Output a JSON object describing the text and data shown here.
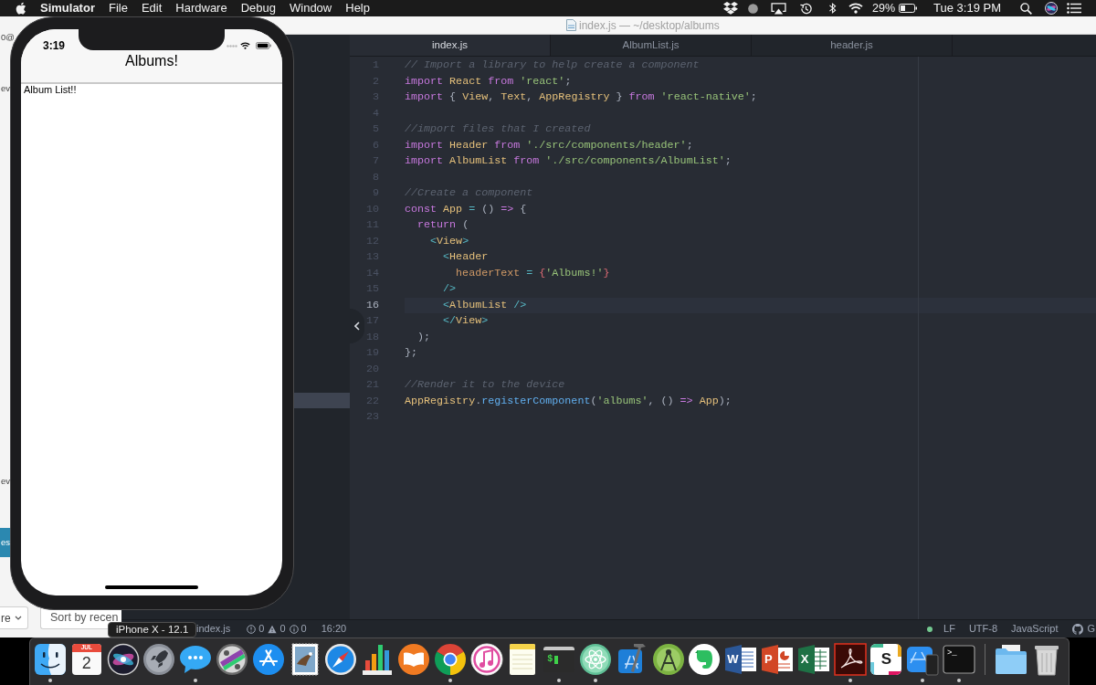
{
  "menu_bar": {
    "app_name": "Simulator",
    "menus": [
      "File",
      "Edit",
      "Hardware",
      "Debug",
      "Window",
      "Help"
    ],
    "battery": "29%",
    "clock": "Tue 3:19 PM"
  },
  "background_window": {
    "fragments": [
      "0@",
      "ev",
      "ev"
    ],
    "action_button": "es",
    "dropdown": "re",
    "sort_button": "Sort by recen"
  },
  "editor": {
    "title": "index.js — ~/desktop/albums",
    "tabs": [
      {
        "label": "index.js",
        "selected": true
      },
      {
        "label": "AlbumList.js",
        "selected": false
      },
      {
        "label": "header.js",
        "selected": false
      }
    ],
    "lines": [
      {
        "number": "1",
        "cursor": false,
        "tokens": [
          {
            "kind": "comment",
            "text": "// Import a library to help create a component"
          }
        ]
      },
      {
        "number": "2",
        "cursor": false,
        "tokens": [
          {
            "kind": "keyword",
            "text": "import "
          },
          {
            "kind": "name",
            "text": "React "
          },
          {
            "kind": "keyword",
            "text": "from "
          },
          {
            "kind": "string",
            "text": "'react'"
          },
          {
            "kind": "punct",
            "text": ";"
          }
        ]
      },
      {
        "number": "3",
        "cursor": false,
        "tokens": [
          {
            "kind": "keyword",
            "text": "import "
          },
          {
            "kind": "punct",
            "text": "{ "
          },
          {
            "kind": "name",
            "text": "View"
          },
          {
            "kind": "punct",
            "text": ", "
          },
          {
            "kind": "name",
            "text": "Text"
          },
          {
            "kind": "punct",
            "text": ", "
          },
          {
            "kind": "name",
            "text": "AppRegistry"
          },
          {
            "kind": "punct",
            "text": " } "
          },
          {
            "kind": "keyword",
            "text": "from "
          },
          {
            "kind": "string",
            "text": "'react-native'"
          },
          {
            "kind": "punct",
            "text": ";"
          }
        ]
      },
      {
        "number": "4",
        "cursor": false
      },
      {
        "number": "5",
        "cursor": false,
        "tokens": [
          {
            "kind": "comment",
            "text": "//import files that I created"
          }
        ]
      },
      {
        "number": "6",
        "cursor": false,
        "tokens": [
          {
            "kind": "keyword",
            "text": "import "
          },
          {
            "kind": "name",
            "text": "Header "
          },
          {
            "kind": "keyword",
            "text": "from "
          },
          {
            "kind": "string",
            "text": "'./src/components/header'"
          },
          {
            "kind": "punct",
            "text": ";"
          }
        ]
      },
      {
        "number": "7",
        "cursor": false,
        "tokens": [
          {
            "kind": "keyword",
            "text": "import "
          },
          {
            "kind": "name",
            "text": "AlbumList "
          },
          {
            "kind": "keyword",
            "text": "from "
          },
          {
            "kind": "string",
            "text": "'./src/components/AlbumList'"
          },
          {
            "kind": "punct",
            "text": ";"
          }
        ]
      },
      {
        "number": "8",
        "cursor": false
      },
      {
        "number": "9",
        "cursor": false,
        "tokens": [
          {
            "kind": "comment",
            "text": "//Create a component"
          }
        ]
      },
      {
        "number": "10",
        "cursor": false,
        "tokens": [
          {
            "kind": "keyword",
            "text": "const "
          },
          {
            "kind": "name",
            "text": "App "
          },
          {
            "kind": "operator",
            "text": "= "
          },
          {
            "kind": "punct",
            "text": "() "
          },
          {
            "kind": "keyword",
            "text": "=> "
          },
          {
            "kind": "punct",
            "text": "{"
          }
        ]
      },
      {
        "number": "11",
        "cursor": false,
        "tokens": [
          {
            "kind": "keyword",
            "text": "  return "
          },
          {
            "kind": "punct",
            "text": "("
          }
        ]
      },
      {
        "number": "12",
        "cursor": false,
        "tokens": [
          {
            "kind": "tag",
            "text": "    <"
          },
          {
            "kind": "name",
            "text": "View"
          },
          {
            "kind": "tag",
            "text": ">"
          }
        ]
      },
      {
        "number": "13",
        "cursor": false,
        "tokens": [
          {
            "kind": "tag",
            "text": "      <"
          },
          {
            "kind": "name",
            "text": "Header"
          }
        ]
      },
      {
        "number": "14",
        "cursor": false,
        "tokens": [
          {
            "kind": "attr",
            "text": "        headerText "
          },
          {
            "kind": "operator",
            "text": "= "
          },
          {
            "kind": "brace",
            "text": "{"
          },
          {
            "kind": "string",
            "text": "'Albums!'"
          },
          {
            "kind": "brace",
            "text": "}"
          }
        ]
      },
      {
        "number": "15",
        "cursor": false,
        "tokens": [
          {
            "kind": "tag",
            "text": "      />"
          }
        ]
      },
      {
        "number": "16",
        "cursor": true,
        "tokens": [
          {
            "kind": "tag",
            "text": "      <"
          },
          {
            "kind": "name",
            "text": "AlbumList "
          },
          {
            "kind": "tag",
            "text": "/>"
          }
        ]
      },
      {
        "number": "17",
        "cursor": false,
        "tokens": [
          {
            "kind": "tag",
            "text": "      </"
          },
          {
            "kind": "name",
            "text": "View"
          },
          {
            "kind": "tag",
            "text": ">"
          }
        ]
      },
      {
        "number": "18",
        "cursor": false,
        "tokens": [
          {
            "kind": "punct",
            "text": "  );"
          }
        ]
      },
      {
        "number": "19",
        "cursor": false,
        "tokens": [
          {
            "kind": "punct",
            "text": "};"
          }
        ]
      },
      {
        "number": "20",
        "cursor": false
      },
      {
        "number": "21",
        "cursor": false,
        "tokens": [
          {
            "kind": "comment",
            "text": "//Render it to the device"
          }
        ]
      },
      {
        "number": "22",
        "cursor": false,
        "tokens": [
          {
            "kind": "name",
            "text": "AppRegistry"
          },
          {
            "kind": "punct",
            "text": "."
          },
          {
            "kind": "func",
            "text": "registerComponent"
          },
          {
            "kind": "punct",
            "text": "("
          },
          {
            "kind": "string",
            "text": "'albums'"
          },
          {
            "kind": "punct",
            "text": ", () "
          },
          {
            "kind": "keyword",
            "text": "=> "
          },
          {
            "kind": "name",
            "text": "App"
          },
          {
            "kind": "punct",
            "text": ");"
          }
        ]
      },
      {
        "number": "23",
        "cursor": false
      }
    ],
    "status_bar": {
      "file": "index.js",
      "errors": "0",
      "warnings": "0",
      "infos": "0",
      "cursor": "16:20",
      "line_ending": "LF",
      "encoding": "UTF-8",
      "grammar": "JavaScript",
      "github": "G"
    }
  },
  "simulator": {
    "time": "3:19",
    "header_title": "Albums!",
    "body_text": "Album List!!",
    "tooltip": "iPhone X - 12.1"
  },
  "dock": {
    "apps": [
      {
        "kind": "face",
        "running": true
      },
      {
        "kind": "calendar",
        "month": "JUL",
        "day": "2",
        "running": false
      },
      {
        "kind": "orb",
        "running": false
      },
      {
        "kind": "rocket",
        "running": false
      },
      {
        "kind": "bubble",
        "running": true
      },
      {
        "kind": "reel",
        "running": false
      },
      {
        "kind": "appstore",
        "running": false
      },
      {
        "kind": "stamp",
        "running": false
      },
      {
        "kind": "compass",
        "running": false
      },
      {
        "kind": "chart",
        "running": false
      },
      {
        "kind": "book",
        "running": false
      },
      {
        "kind": "ring",
        "running": true
      },
      {
        "kind": "note",
        "running": false
      },
      {
        "kind": "notepad",
        "running": false
      },
      {
        "kind": "console",
        "glyph": "$",
        "running": true
      },
      {
        "kind": "atom",
        "running": true
      },
      {
        "kind": "hammer",
        "running": false
      },
      {
        "kind": "android",
        "running": false
      },
      {
        "kind": "elephant",
        "running": false
      },
      {
        "kind": "word",
        "glyph": "W",
        "running": false
      },
      {
        "kind": "slides",
        "glyph": "P",
        "running": false
      },
      {
        "kind": "sheet",
        "glyph": "X",
        "running": false
      },
      {
        "kind": "swirl",
        "running": true
      },
      {
        "kind": "tile",
        "glyph": "S",
        "running": false
      },
      {
        "kind": "device",
        "running": true
      },
      {
        "kind": "terminal",
        "glyph": ">_",
        "running": true
      }
    ],
    "stack": [
      {
        "kind": "folder",
        "running": false
      },
      {
        "kind": "trash",
        "running": false
      }
    ]
  }
}
